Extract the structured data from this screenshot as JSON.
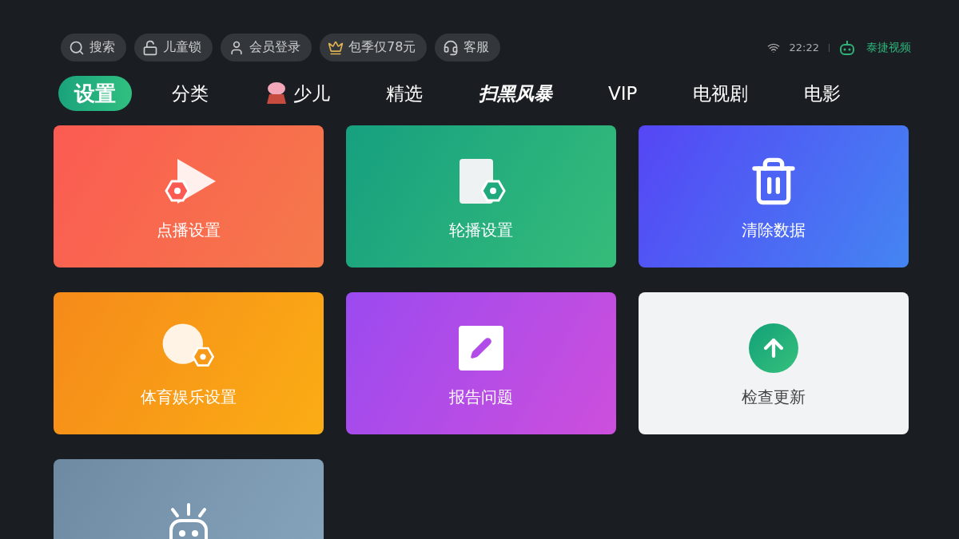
{
  "top_bar": {
    "chips": [
      {
        "label": "搜索"
      },
      {
        "label": "儿童锁"
      },
      {
        "label": "会员登录"
      },
      {
        "label": "包季仅78元"
      },
      {
        "label": "客服"
      }
    ],
    "time": "22:22",
    "brand": "泰捷视频"
  },
  "tabs": [
    {
      "label": "设置",
      "selected": true
    },
    {
      "label": "分类",
      "selected": false
    },
    {
      "label": "少儿",
      "selected": false
    },
    {
      "label": "精选",
      "selected": false
    },
    {
      "label": "扫黑风暴",
      "selected": false
    },
    {
      "label": "VIP",
      "selected": false
    },
    {
      "label": "电视剧",
      "selected": false
    },
    {
      "label": "电影",
      "selected": false
    }
  ],
  "cards": [
    {
      "kind": "labeled",
      "label": "点播设置"
    },
    {
      "kind": "labeled",
      "label": "轮播设置"
    },
    {
      "kind": "labeled",
      "label": "清除数据"
    },
    {
      "kind": "labeled",
      "label": "体育娱乐设置"
    },
    {
      "kind": "labeled",
      "label": "报告问题"
    },
    {
      "kind": "labeled",
      "label": "检查更新"
    },
    {
      "kind": "icon_only"
    }
  ]
}
